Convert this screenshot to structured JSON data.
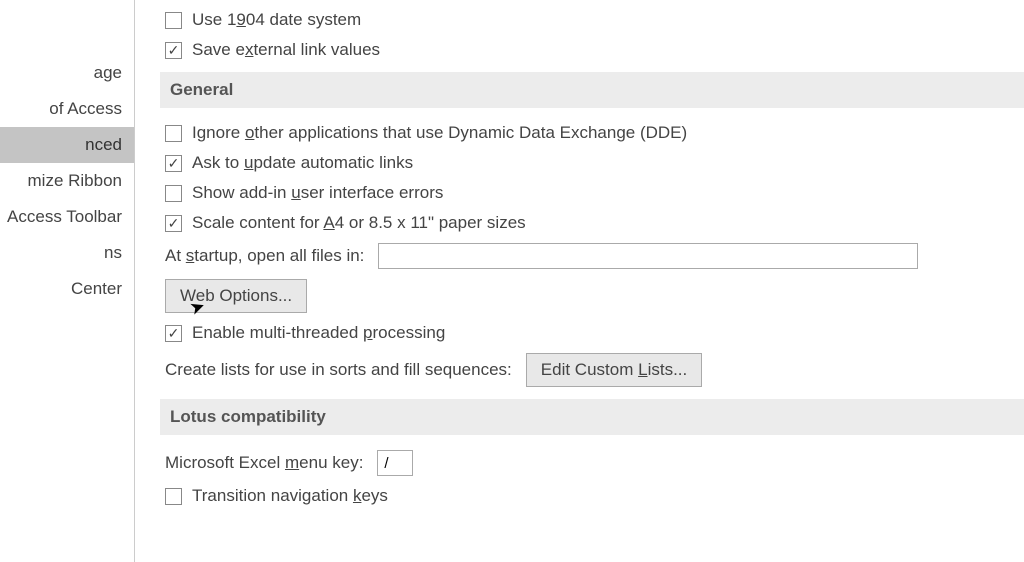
{
  "sidebar": {
    "items": [
      {
        "label": "age"
      },
      {
        "label": "of Access"
      },
      {
        "label": "nced"
      },
      {
        "label": "mize Ribbon"
      },
      {
        "label": "Access Toolbar"
      },
      {
        "label": "ns"
      },
      {
        "label": "Center"
      }
    ],
    "selected_index": 2
  },
  "top_options": {
    "use_1904": {
      "label": "Use 1904 date system",
      "checked": false,
      "underline_char": "9"
    },
    "save_external": {
      "label": "Save external link values",
      "checked": true,
      "underline_char": "x"
    }
  },
  "general": {
    "header": "General",
    "ignore_dde": {
      "label_before": "Ignore ",
      "underline": "o",
      "label_after": "ther applications that use Dynamic Data Exchange (DDE)",
      "checked": false
    },
    "ask_update": {
      "label_before": "Ask to ",
      "underline": "u",
      "label_after": "pdate automatic links",
      "checked": true
    },
    "show_addin": {
      "label_before": "Show add-in ",
      "underline": "u",
      "label_after": "ser interface errors",
      "checked": false
    },
    "scale_content": {
      "label_before": "Scale content for ",
      "underline": "A",
      "label_after": "4 or 8.5 x 11\" paper sizes",
      "checked": true
    },
    "startup_label_before": "At ",
    "startup_underline": "s",
    "startup_label_after": "tartup, open all files in:",
    "startup_value": "",
    "web_options_btn": "Web Options...",
    "enable_multi": {
      "label_before": "Enable multi-threaded ",
      "underline": "p",
      "label_after": "rocessing",
      "checked": true
    },
    "create_lists_label": "Create lists for use in sorts and fill sequences:",
    "edit_custom_btn_before": "Edit Custom ",
    "edit_custom_btn_underline": "L",
    "edit_custom_btn_after": "ists..."
  },
  "lotus": {
    "header": "Lotus compatibility",
    "menu_key_label_before": "Microsoft Excel ",
    "menu_key_underline": "m",
    "menu_key_label_after": "enu key:",
    "menu_key_value": "/",
    "transition_nav": {
      "label_before": "Transition navigation ",
      "underline": "k",
      "label_after": "eys",
      "checked": false
    }
  }
}
